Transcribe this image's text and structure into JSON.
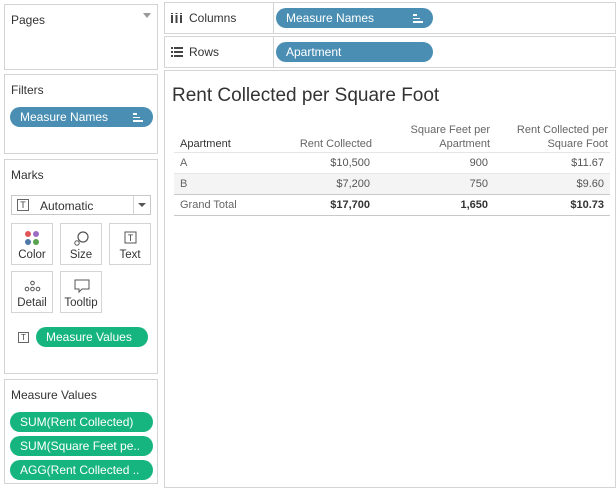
{
  "panels": {
    "pages": {
      "title": "Pages"
    },
    "filters": {
      "title": "Filters",
      "pill": "Measure Names"
    },
    "marks": {
      "title": "Marks",
      "type_dropdown": "Automatic",
      "buttons": {
        "color": "Color",
        "size": "Size",
        "text": "Text",
        "detail": "Detail",
        "tooltip": "Tooltip"
      },
      "pill": "Measure Values"
    },
    "measure_values": {
      "title": "Measure Values",
      "pills": [
        "SUM(Rent Collected)",
        "SUM(Square Feet pe..",
        "AGG(Rent Collected .."
      ]
    }
  },
  "shelves": {
    "columns": {
      "label": "Columns",
      "pill": "Measure Names"
    },
    "rows": {
      "label": "Rows",
      "pill": "Apartment"
    }
  },
  "view": {
    "title": "Rent Collected per Square Foot",
    "headers": {
      "apartment": "Apartment",
      "rent": "Rent Collected",
      "sqft_line1": "Square Feet per",
      "sqft_line2": "Apartment",
      "per_line1": "Rent Collected per",
      "per_line2": "Square Foot"
    },
    "rows": [
      {
        "apartment": "A",
        "rent": "$10,500",
        "sqft": "900",
        "per": "$11.67"
      },
      {
        "apartment": "B",
        "rent": "$7,200",
        "sqft": "750",
        "per": "$9.60"
      }
    ],
    "total": {
      "label": "Grand Total",
      "rent": "$17,700",
      "sqft": "1,650",
      "per": "$10.73"
    }
  },
  "colors": {
    "blue_pill": "#4a8fb3",
    "green_pill": "#16b57f"
  }
}
